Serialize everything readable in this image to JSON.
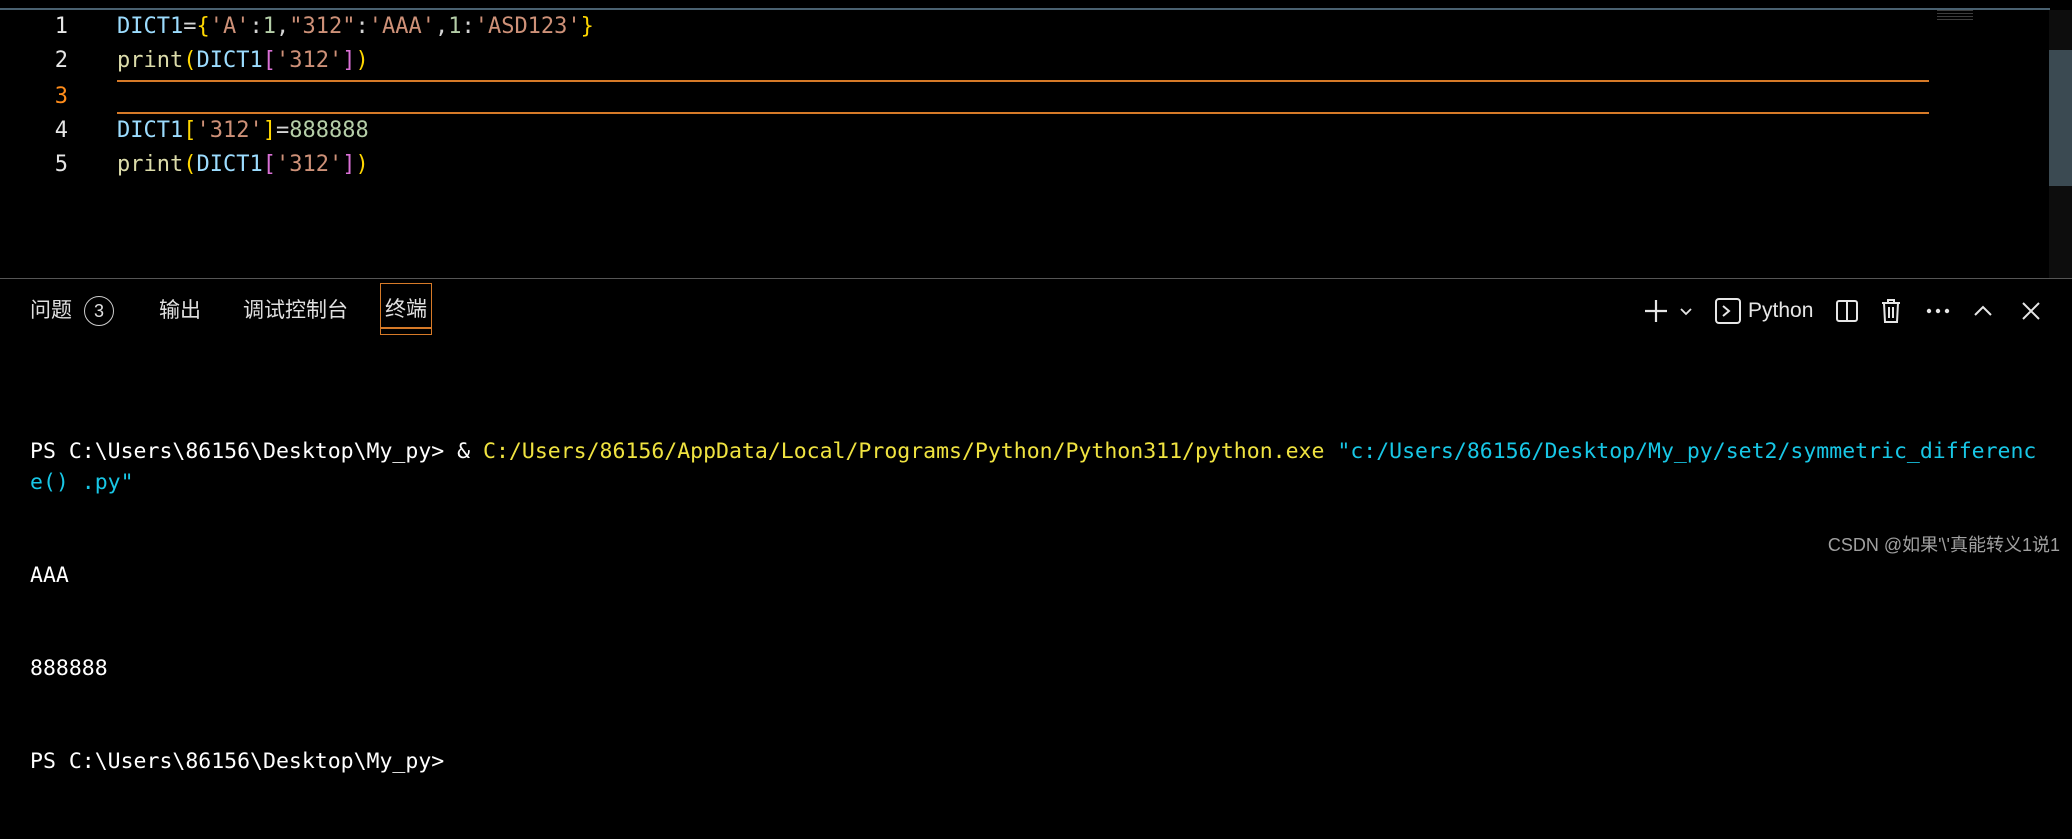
{
  "editor": {
    "lines": [
      {
        "number": "1",
        "tokens": [
          {
            "t": "DICT1",
            "c": "var"
          },
          {
            "t": "=",
            "c": "op"
          },
          {
            "t": "{",
            "c": "br1"
          },
          {
            "t": "'A'",
            "c": "str"
          },
          {
            "t": ":",
            "c": "op"
          },
          {
            "t": "1",
            "c": "num"
          },
          {
            "t": ",",
            "c": "op"
          },
          {
            "t": "\"312\"",
            "c": "str"
          },
          {
            "t": ":",
            "c": "op"
          },
          {
            "t": "'AAA'",
            "c": "str"
          },
          {
            "t": ",",
            "c": "op"
          },
          {
            "t": "1",
            "c": "num"
          },
          {
            "t": ":",
            "c": "op"
          },
          {
            "t": "'ASD123'",
            "c": "str"
          },
          {
            "t": "}",
            "c": "br1"
          }
        ]
      },
      {
        "number": "2",
        "tokens": [
          {
            "t": "print",
            "c": "fn"
          },
          {
            "t": "(",
            "c": "br1"
          },
          {
            "t": "DICT1",
            "c": "var"
          },
          {
            "t": "[",
            "c": "br2"
          },
          {
            "t": "'312'",
            "c": "str"
          },
          {
            "t": "]",
            "c": "br2"
          },
          {
            "t": ")",
            "c": "br1"
          }
        ]
      },
      {
        "number": "3",
        "tokens": [],
        "active": true
      },
      {
        "number": "4",
        "tokens": [
          {
            "t": "DICT1",
            "c": "var"
          },
          {
            "t": "[",
            "c": "br1"
          },
          {
            "t": "'312'",
            "c": "str"
          },
          {
            "t": "]",
            "c": "br1"
          },
          {
            "t": "=",
            "c": "op"
          },
          {
            "t": "888888",
            "c": "num"
          }
        ]
      },
      {
        "number": "5",
        "tokens": [
          {
            "t": "print",
            "c": "fn"
          },
          {
            "t": "(",
            "c": "br1"
          },
          {
            "t": "DICT1",
            "c": "var"
          },
          {
            "t": "[",
            "c": "br2"
          },
          {
            "t": "'312'",
            "c": "str"
          },
          {
            "t": "]",
            "c": "br2"
          },
          {
            "t": ")",
            "c": "br1"
          }
        ]
      }
    ],
    "colors": {
      "var": "#9cdcfe",
      "fn": "#dcdcaa",
      "br1": "#ffd700",
      "br2": "#da70d6",
      "str": "#ce9178",
      "num": "#b5cea8",
      "op": "#d4d4d4",
      "active_line": "#ff8c1a"
    }
  },
  "panel": {
    "tabs": {
      "problems": "问题",
      "problems_count": "3",
      "output": "输出",
      "debug_console": "调试控制台",
      "terminal": "终端"
    },
    "toolbar": {
      "shell_name": "Python",
      "icons": [
        "plus-icon",
        "chevron-down-icon",
        "terminal-icon",
        "split-icon",
        "trash-icon",
        "more-icon",
        "chevron-up-icon",
        "close-icon"
      ]
    },
    "terminal": {
      "line1_prompt": "PS C:\\Users\\86156\\Desktop\\My_py> & ",
      "line1_exe": "C:/Users/86156/AppData/Local/Programs/Python/Python311/python.exe",
      "line1_space": " ",
      "line1_script": "\"c:/Users/86156/Desktop/My_py/set2/symmetric_difference() .py\"",
      "output1": "AAA",
      "output2": "888888",
      "prompt_last": "PS C:\\Users\\86156\\Desktop\\My_py>"
    }
  },
  "watermark": "CSDN @如果'\\'真能转义1说1"
}
